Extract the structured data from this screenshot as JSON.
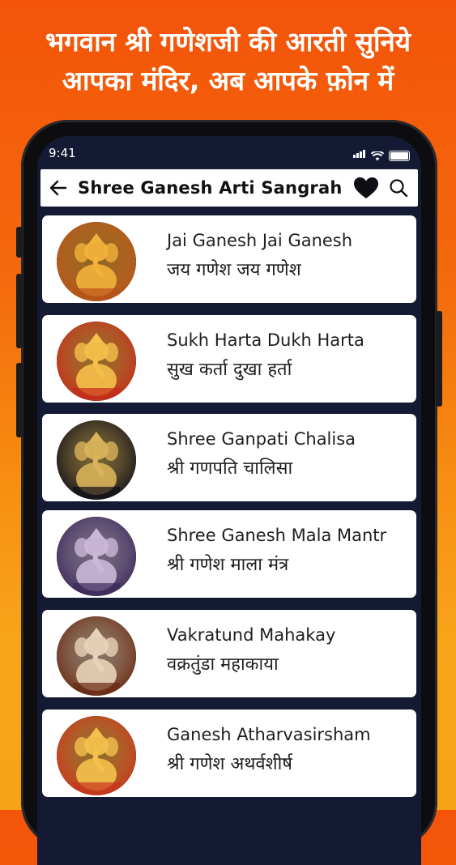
{
  "promo": {
    "line1": "भगवान श्री गणेशजी की आरती सुनिये",
    "line2": "आपका मंदिर, अब आपके फ़ोन में"
  },
  "status_bar": {
    "time": "9:41"
  },
  "app_bar": {
    "title": "Shree Ganesh Arti Sangrah",
    "icons": [
      "arrow-left-icon",
      "heart-icon",
      "search-icon"
    ]
  },
  "items": [
    {
      "english": "Jai Ganesh Jai Ganesh",
      "hindi": "जय गणेश जय गणेश",
      "thumb_bg": "#b8521a",
      "thumb_fg": "#f2b13a"
    },
    {
      "english": "Sukh Harta Dukh Harta",
      "hindi": "सुख कर्ता दुखा हर्ता",
      "thumb_bg": "#c42a1a",
      "thumb_fg": "#f5c04a"
    },
    {
      "english": "Shree Ganpati Chalisa",
      "hindi": "श्री गणपति चालिसा",
      "thumb_bg": "#101018",
      "thumb_fg": "#d9b35a"
    },
    {
      "english": "Shree Ganesh Mala Mantr",
      "hindi": "श्री गणेश माला मंत्र",
      "thumb_bg": "#3b2a5a",
      "thumb_fg": "#cbb8d8"
    },
    {
      "english": "Vakratund Mahakay",
      "hindi": "वक्रतुंडा महाकाया",
      "thumb_bg": "#6a2a12",
      "thumb_fg": "#e8d2b8"
    },
    {
      "english": "Ganesh Atharvasirsham",
      "hindi": "श्री गणेश अथर्वशीर्ष",
      "thumb_bg": "#c7351c",
      "thumb_fg": "#f3c14c"
    }
  ],
  "colors": {
    "background_top": "#f3540a",
    "background_bottom": "#f6a316",
    "screen_bg": "#151a34",
    "card_bg": "#ffffff"
  }
}
